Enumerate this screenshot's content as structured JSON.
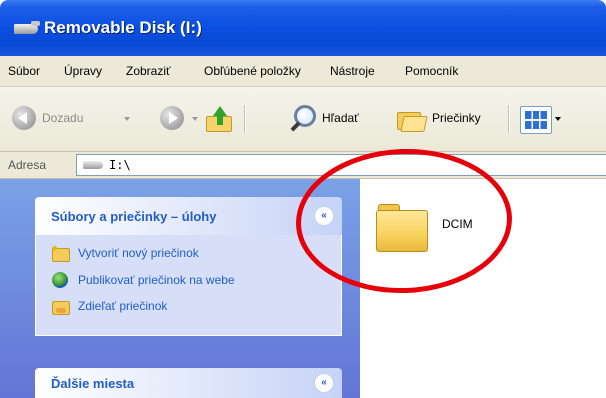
{
  "window": {
    "title": "Removable Disk (I:)"
  },
  "menu": [
    "Súbor",
    "Úpravy",
    "Zobraziť",
    "Obľúbené položky",
    "Nástroje",
    "Pomocník"
  ],
  "toolbar": {
    "back_label": "Dozadu",
    "search_label": "Hľadať",
    "folders_label": "Priečinky"
  },
  "address": {
    "label": "Adresa",
    "value": "I:\\"
  },
  "task_panel": {
    "title": "Súbory a priečinky – úlohy",
    "collapse_glyph": "«",
    "tasks": [
      {
        "label": "Vytvoriť nový priečinok",
        "icon": "new-folder-icon"
      },
      {
        "label": "Publikovať priečinok na webe",
        "icon": "publish-web-icon"
      },
      {
        "label": "Zdieľať priečinok",
        "icon": "share-folder-icon"
      }
    ]
  },
  "other_places": {
    "title": "Ďalšie miesta",
    "collapse_glyph": "«"
  },
  "files": [
    {
      "name": "DCIM",
      "icon": "folder-icon"
    }
  ],
  "colors": {
    "title_bar": "#0a4fe0",
    "task_link": "#215dc6",
    "annotation_circle": "#e5000a"
  }
}
